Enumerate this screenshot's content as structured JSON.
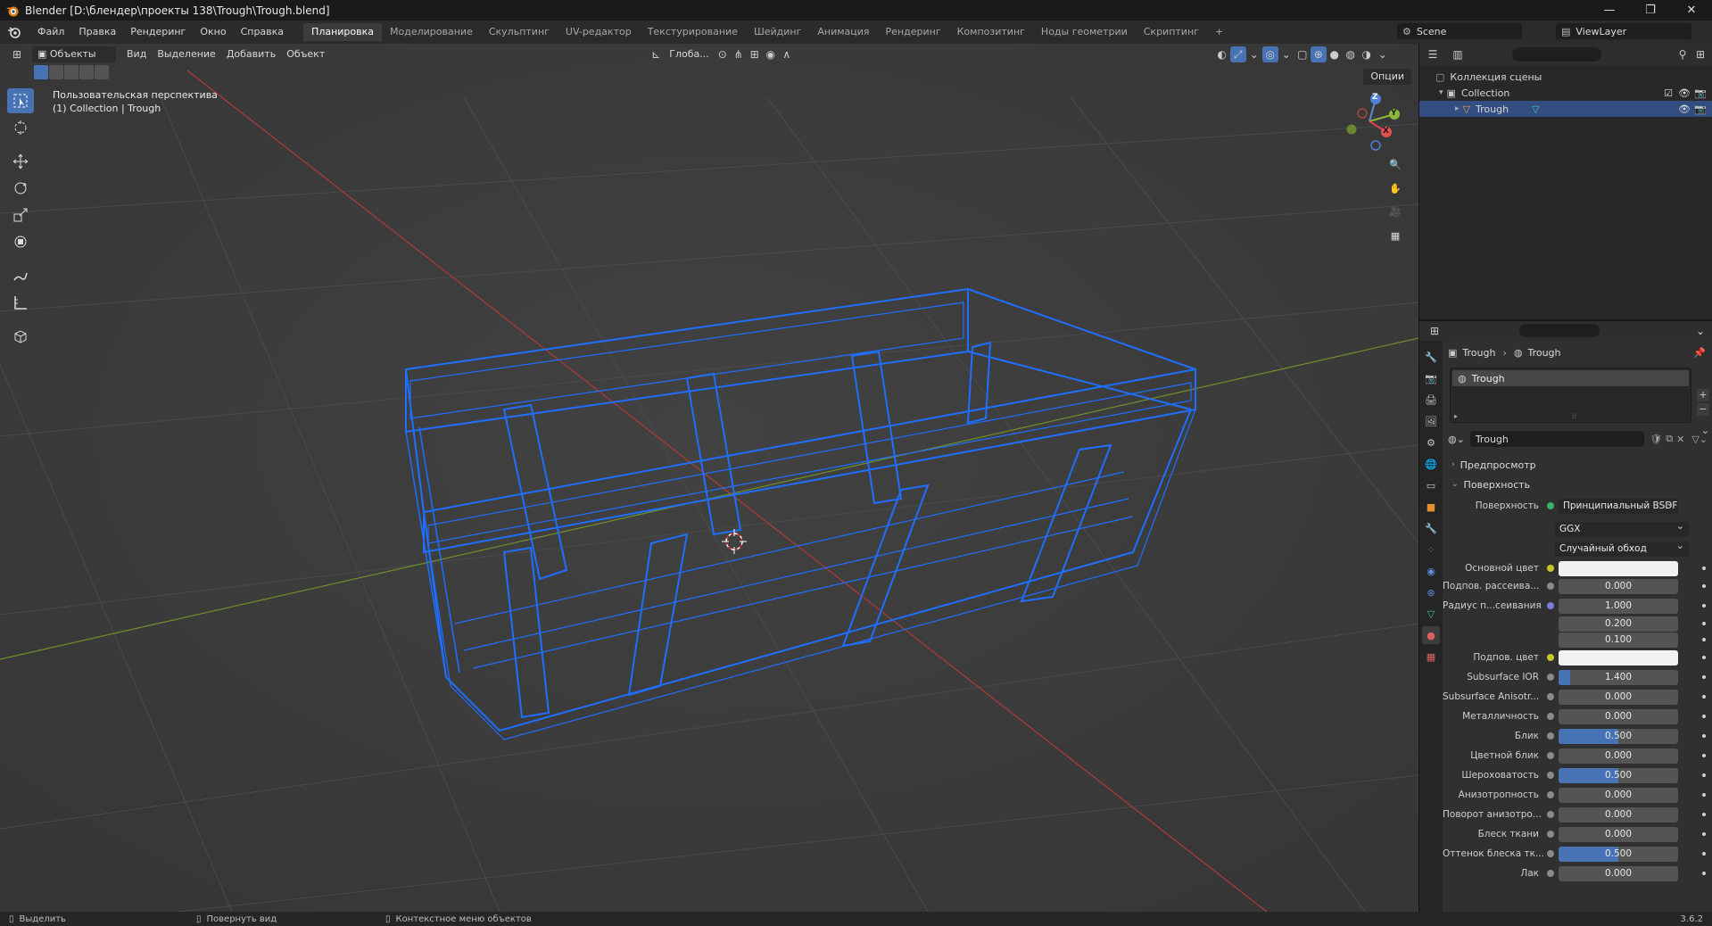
{
  "window": {
    "title": "Blender [D:\\блендер\\проекты 138\\Trough\\Trough.blend]",
    "minimize": "—",
    "maximize": "❐",
    "close": "✕"
  },
  "menu": [
    "Файл",
    "Правка",
    "Рендеринг",
    "Окно",
    "Справка"
  ],
  "workspaces": [
    {
      "label": "Планировка",
      "active": true
    },
    {
      "label": "Моделирование"
    },
    {
      "label": "Скульптинг"
    },
    {
      "label": "UV-редактор"
    },
    {
      "label": "Текстурирование"
    },
    {
      "label": "Шейдинг"
    },
    {
      "label": "Анимация"
    },
    {
      "label": "Рендеринг"
    },
    {
      "label": "Композитинг"
    },
    {
      "label": "Ноды геометрии"
    },
    {
      "label": "Скриптинг"
    }
  ],
  "add_workspace": "+",
  "scene": {
    "name": "Scene",
    "view_layer": "ViewLayer"
  },
  "viewport": {
    "mode": "Объекты",
    "menus": [
      "Вид",
      "Выделение",
      "Добавить",
      "Объект"
    ],
    "transform_orientation": "Глоба...",
    "options": "Опции",
    "view_name": "Пользовательская перспектива",
    "collection_info": "(1) Collection | Trough",
    "gizmo": {
      "z": "Z",
      "y": "Y",
      "x": "X"
    },
    "wire_color": "#1f6fff"
  },
  "outliner": {
    "root": "Коллекция сцены",
    "collection": "Collection",
    "object": "Trough"
  },
  "properties": {
    "breadcrumb": [
      "Trough",
      "Trough"
    ],
    "slot": "Trough",
    "material": "Trough",
    "panels": {
      "preview": "Предпросмотр",
      "surface": "Поверхность"
    },
    "surface_label": "Поверхность",
    "surface_shader": "Принципиальный BSDF",
    "distribution": "GGX",
    "subsurface_method": "Случайный обход",
    "rows": [
      {
        "label": "Основной цвет",
        "type": "color",
        "color": "#f0f0f0"
      },
      {
        "label": "Подпов. рассеива...",
        "value": "0.000",
        "fill": 0
      },
      {
        "label": "Радиус п...сеивания",
        "value": "1.000",
        "fill": 0,
        "dot": "#7b7bd9"
      },
      {
        "label": "",
        "value": "0.200",
        "fill": 0,
        "nodot": true
      },
      {
        "label": "",
        "value": "0.100",
        "fill": 0,
        "nodot": true
      },
      {
        "label": "Подпов. цвет",
        "type": "color",
        "color": "#f2f2f2"
      },
      {
        "label": "Subsurface IOR",
        "value": "1.400",
        "fill": 0.1
      },
      {
        "label": "Subsurface Anisotr...",
        "value": "0.000",
        "fill": 0
      },
      {
        "label": "Металличность",
        "value": "0.000",
        "fill": 0
      },
      {
        "label": "Блик",
        "value": "0.500",
        "fill": 0.5
      },
      {
        "label": "Цветной блик",
        "value": "0.000",
        "fill": 0
      },
      {
        "label": "Шероховатость",
        "value": "0.500",
        "fill": 0.5
      },
      {
        "label": "Анизотропность",
        "value": "0.000",
        "fill": 0
      },
      {
        "label": "Поворот анизотро...",
        "value": "0.000",
        "fill": 0
      },
      {
        "label": "Блеск ткани",
        "value": "0.000",
        "fill": 0
      },
      {
        "label": "Оттенок блеска тк...",
        "value": "0.500",
        "fill": 0.5
      },
      {
        "label": "Лак",
        "value": "0.000",
        "fill": 0
      }
    ]
  },
  "status": {
    "select": "Выделить",
    "rotate": "Повернуть вид",
    "context": "Контекстное меню объектов",
    "version": "3.6.2"
  }
}
